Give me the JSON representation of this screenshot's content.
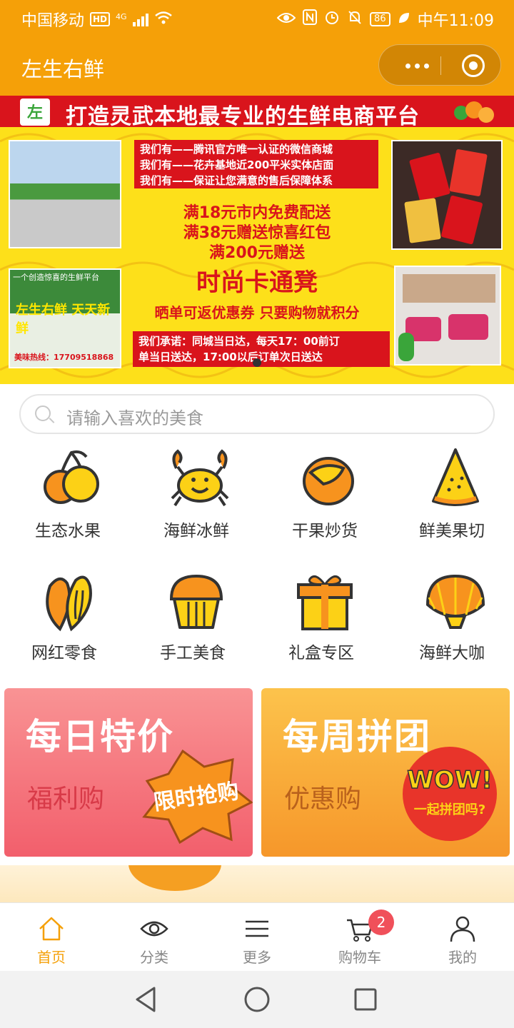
{
  "status_bar": {
    "carrier": "中国移动",
    "hd": "HD",
    "net": "4G",
    "battery": "86",
    "time": "中午11:09"
  },
  "header": {
    "title": "左生右鲜",
    "capsule_icons": [
      "more-icon",
      "target-icon"
    ]
  },
  "banner": {
    "logo_text": "左",
    "headline": "打造灵武本地最专业的生鲜电商平台",
    "box1_lines": [
      "我们有——腾讯官方唯一认证的微信商城",
      "我们有——花卉基地近200平米实体店面",
      "我们有——保证让您满意的售后保障体系"
    ],
    "offer1": "满18元市内免费配送",
    "offer2": "满38元赠送惊喜红包",
    "offer3": "满200元赠送",
    "offer4": "时尚卡通凳",
    "offer5": "晒单可返优惠券  只要购物就积分",
    "box2_lines": [
      "我们承诺：同城当日达，每天17：00前订",
      "单当日送达，17:00以后订单次日送达"
    ],
    "store_sub": "一个创造惊喜的生鲜平台",
    "store_slogan": "左生右鲜  天天新鲜",
    "store_hotline": "美味热线：17709518868"
  },
  "search": {
    "placeholder": "请输入喜欢的美食"
  },
  "categories": [
    {
      "label": "生态水果",
      "icon": "cherry-icon"
    },
    {
      "label": "海鲜冰鲜",
      "icon": "crab-icon"
    },
    {
      "label": "干果炒货",
      "icon": "pistachio-icon"
    },
    {
      "label": "鲜美果切",
      "icon": "melon-slice-icon"
    },
    {
      "label": "网红零食",
      "icon": "sunflower-seed-icon"
    },
    {
      "label": "手工美食",
      "icon": "muffin-icon"
    },
    {
      "label": "礼盒专区",
      "icon": "gift-box-icon"
    },
    {
      "label": "海鲜大咖",
      "icon": "shell-icon"
    }
  ],
  "promos": [
    {
      "title": "每日特价",
      "subtitle": "福利购",
      "badge": "限时抢购"
    },
    {
      "title": "每周拼团",
      "subtitle": "优惠购",
      "badge_top": "WOW!",
      "badge_bottom": "一起拼团吗?"
    }
  ],
  "tabbar": {
    "items": [
      {
        "label": "首页",
        "icon": "home-icon",
        "active": true
      },
      {
        "label": "分类",
        "icon": "eye-icon",
        "active": false
      },
      {
        "label": "更多",
        "icon": "menu-icon",
        "active": false
      },
      {
        "label": "购物车",
        "icon": "cart-icon",
        "active": false
      },
      {
        "label": "我的",
        "icon": "user-icon",
        "active": false
      }
    ],
    "cart_count": "2"
  },
  "colors": {
    "brand": "#f5a008",
    "accent_red": "#d9141c",
    "badge": "#f0505a"
  }
}
